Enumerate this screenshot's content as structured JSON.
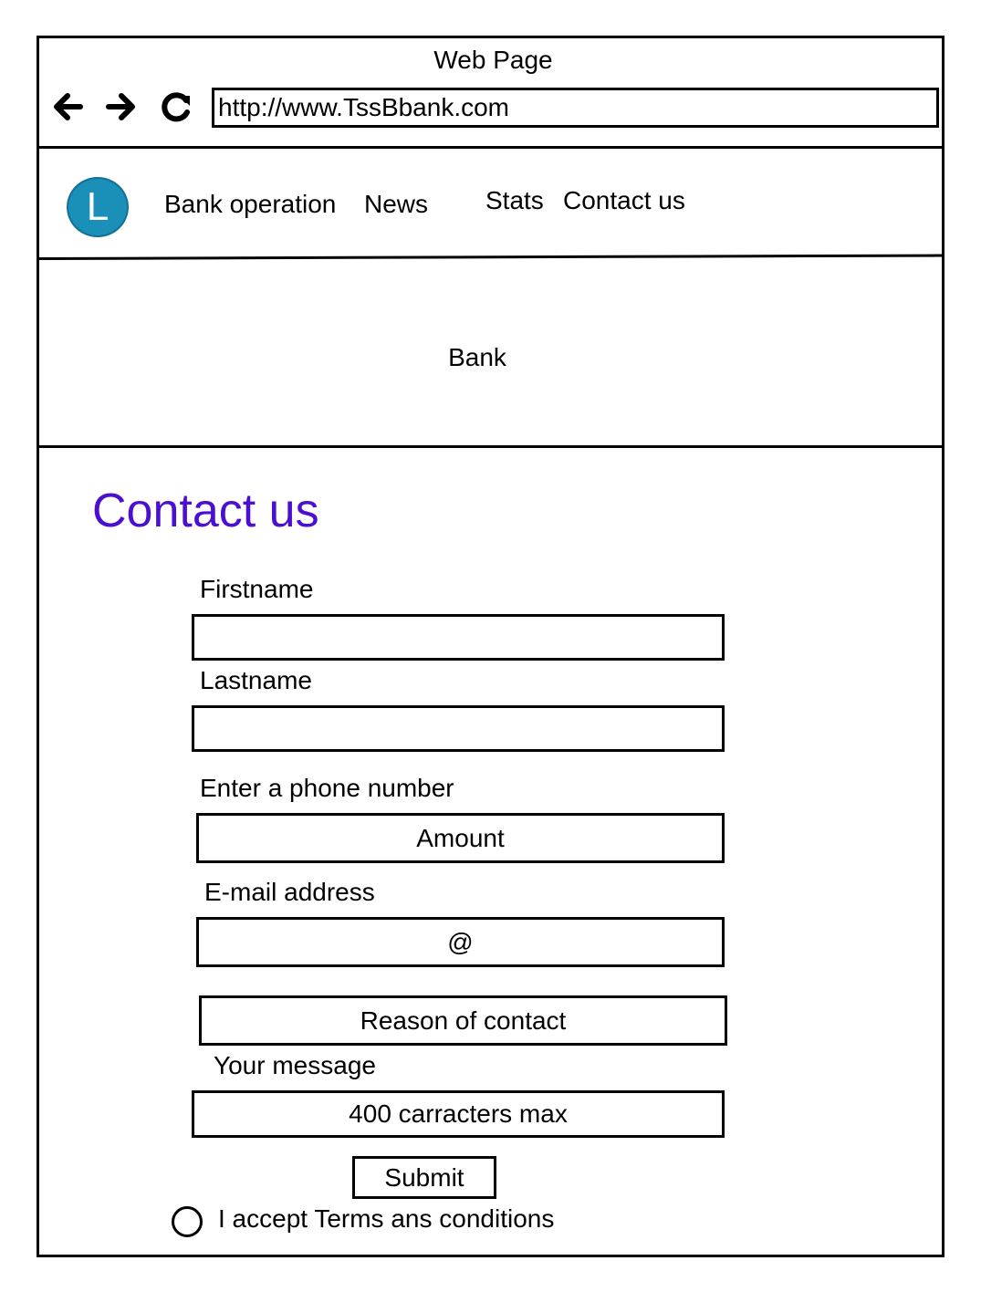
{
  "window": {
    "title": "Web Page",
    "url": "http://www.TssBbank.com"
  },
  "toolbar": {
    "back_icon": "arrow-left-icon",
    "forward_icon": "arrow-right-icon",
    "reload_icon": "reload-icon"
  },
  "header": {
    "logo_letter": "L",
    "logo_color": "#1a8fb8",
    "menu": [
      {
        "label": "Bank operation"
      },
      {
        "label": "News"
      },
      {
        "label": "Stats"
      },
      {
        "label": "Contact us"
      }
    ]
  },
  "hero": {
    "text": "Bank"
  },
  "contact": {
    "title": "Contact us",
    "title_color": "#4b0fd1",
    "firstname_label": "Firstname",
    "firstname_value": "",
    "lastname_label": "Lastname",
    "lastname_value": "",
    "phone_label": "Enter a phone number",
    "phone_placeholder": "Amount",
    "email_label": "E-mail address",
    "email_placeholder": "@",
    "reason_placeholder": "Reason of contact",
    "message_label": "Your message",
    "message_placeholder": "400 carracters max",
    "submit_label": "Submit",
    "terms_label": "I accept Terms ans conditions"
  }
}
